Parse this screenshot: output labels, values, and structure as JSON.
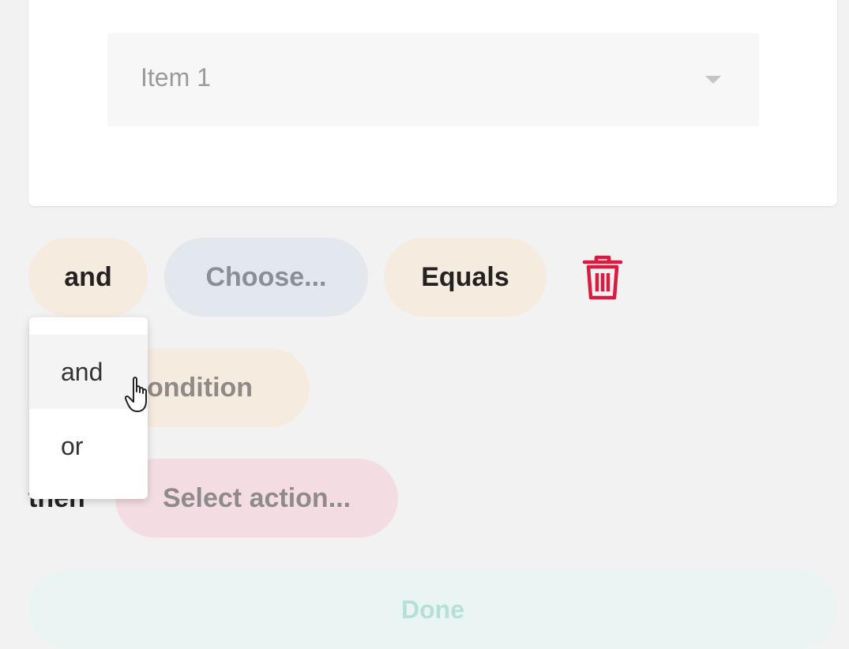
{
  "item_select": {
    "value": "Item 1"
  },
  "condition_row": {
    "operator": "and",
    "field_placeholder": "Choose...",
    "comparison": "Equals"
  },
  "add_condition": {
    "label_visible": "ondition"
  },
  "action_row": {
    "label": "then",
    "action_placeholder": "Select action..."
  },
  "operator_dropdown": {
    "options": [
      "and",
      "or"
    ],
    "hovered": "and"
  },
  "done_button": {
    "label": "Done"
  },
  "colors": {
    "operator_pill": "#f6ebdf",
    "field_pill": "#e3e7ee",
    "action_pill": "#f4dde2",
    "delete_icon": "#d81b3f",
    "done_bg": "#eaf5f3",
    "done_text": "#b6e0d7"
  },
  "icons": {
    "delete": "trash-icon",
    "select": "caret-down-icon",
    "cursor": "hand-pointer-icon"
  }
}
